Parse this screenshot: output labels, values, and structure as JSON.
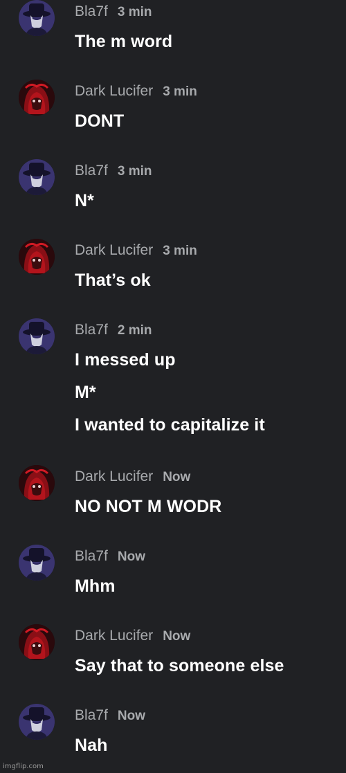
{
  "messages": [
    {
      "author": "Bla7f",
      "time": "3 min",
      "avatar": "hat-figure-avatar",
      "lines": [
        "The m word"
      ]
    },
    {
      "author": "Dark Lucifer",
      "time": "3 min",
      "avatar": "red-anime-avatar",
      "lines": [
        "DONT"
      ]
    },
    {
      "author": "Bla7f",
      "time": "3 min",
      "avatar": "hat-figure-avatar",
      "lines": [
        "N*"
      ]
    },
    {
      "author": "Dark Lucifer",
      "time": "3 min",
      "avatar": "red-anime-avatar",
      "lines": [
        "That’s ok"
      ]
    },
    {
      "author": "Bla7f",
      "time": "2 min",
      "avatar": "hat-figure-avatar",
      "lines": [
        "I messed up",
        "M*",
        "I wanted to capitalize it"
      ]
    },
    {
      "author": "Dark Lucifer",
      "time": "Now",
      "avatar": "red-anime-avatar",
      "lines": [
        "NO NOT M WODR"
      ]
    },
    {
      "author": "Bla7f",
      "time": "Now",
      "avatar": "hat-figure-avatar",
      "lines": [
        "Mhm"
      ]
    },
    {
      "author": "Dark Lucifer",
      "time": "Now",
      "avatar": "red-anime-avatar",
      "lines": [
        "Say that to someone else"
      ]
    },
    {
      "author": "Bla7f",
      "time": "Now",
      "avatar": "hat-figure-avatar",
      "lines": [
        "Nah"
      ]
    }
  ],
  "watermark": "imgflip.com",
  "colors": {
    "background": "#202124",
    "meta_text": "#a8aaad",
    "message_text": "#ffffff"
  }
}
